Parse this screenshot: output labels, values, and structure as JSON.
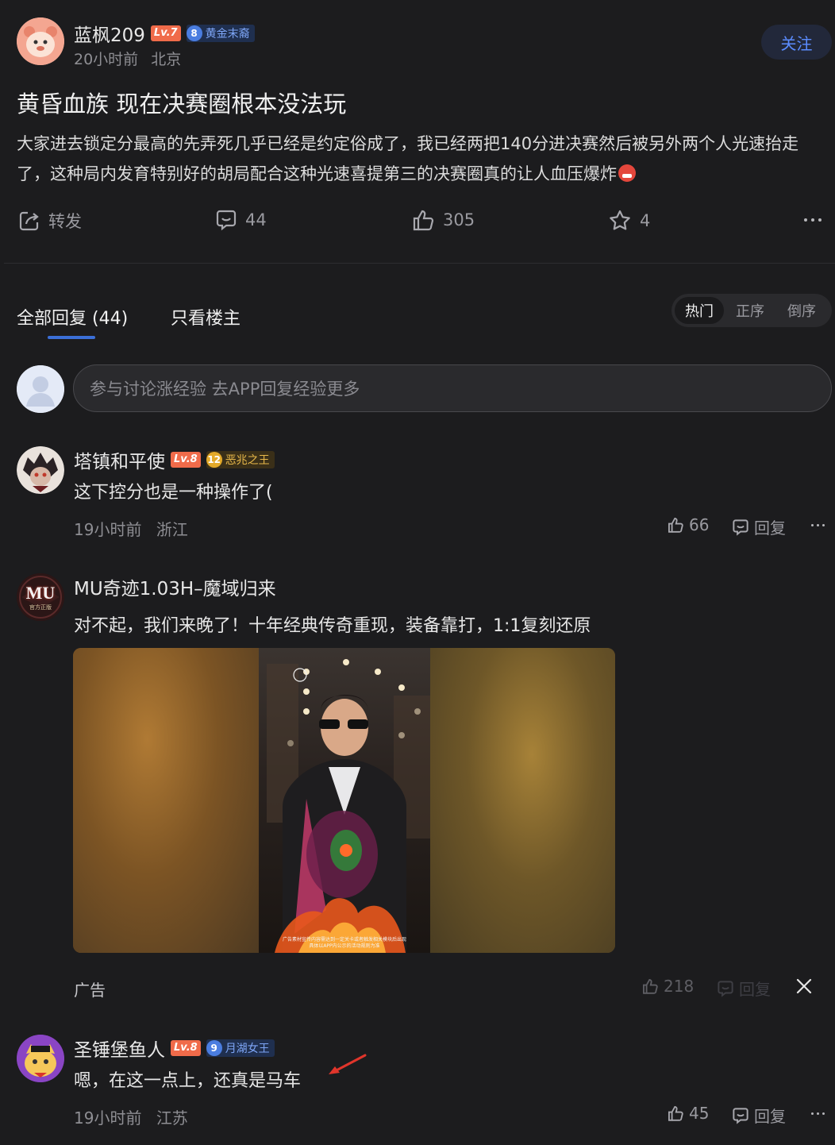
{
  "post": {
    "author": {
      "name": "蓝枫209",
      "level": "Lv.7",
      "badge_num": "8",
      "badge_title": "黄金末裔",
      "time": "20小时前",
      "location": "北京"
    },
    "follow_label": "关注",
    "title": "黄昏血族 现在决赛圈根本没法玩",
    "body": "大家进去锁定分最高的先弄死几乎已经是约定俗成了，我已经两把140分进决赛然后被另外两个人光速抬走了，这种局内发育特别好的胡局配合这种光速喜提第三的决赛圈真的让人血压爆炸",
    "actions": {
      "share_label": "转发",
      "comments": "44",
      "likes": "305",
      "favorites": "4"
    }
  },
  "tabs": {
    "all_replies": "全部回复 (44)",
    "op_only": "只看楼主"
  },
  "sort": {
    "hot": "热门",
    "asc": "正序",
    "desc": "倒序"
  },
  "reply_input": {
    "placeholder": "参与讨论涨经验 去APP回复经验更多"
  },
  "comments": [
    {
      "name": "塔镇和平使",
      "level": "Lv.8",
      "badge_num": "12",
      "badge_title": "恶兆之王",
      "text": "这下控分也是一种操作了(",
      "time": "19小时前",
      "location": "浙江",
      "likes": "66",
      "reply_label": "回复"
    },
    {
      "name": "圣锤堡鱼人",
      "level": "Lv.8",
      "badge_num": "9",
      "badge_title": "月湖女王",
      "text": "嗯，在这一点上，还真是马车",
      "time": "19小时前",
      "location": "江苏",
      "likes": "45",
      "reply_label": "回复"
    }
  ],
  "ad": {
    "name": "MU奇迹1.03H–魔域归来",
    "avatar_text": "MU",
    "avatar_sub": "官方正版",
    "text": "对不起，我们来晚了！十年经典传奇重现，装备靠打，1:1复刻还原",
    "disclaimer_line1": "广告素材宣传内容需达到一定关卡或者触发相关模块后出现",
    "disclaimer_line2": "具体以APP内公示的活动规则为准",
    "label": "广告",
    "likes": "218",
    "reply_label": "回复"
  },
  "colors": {
    "background": "#1c1c1e",
    "accent_blue": "#3b6fd8",
    "level_orange": "#f06b4a",
    "gold": "#e3a929",
    "follow_text": "#5b8cff"
  }
}
